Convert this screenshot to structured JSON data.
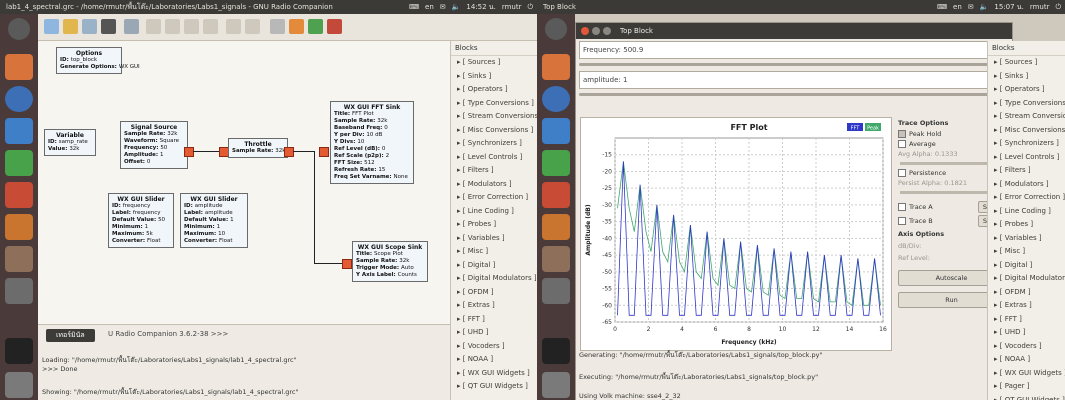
{
  "left_window": {
    "title": "lab1_4_spectral.grc - /home/rmutr/พื้นโต๊ะ/Laboratories/Labs1_signals - GNU Radio Companion",
    "status": {
      "lang": "en",
      "time": "14:52 น.",
      "user": "rmutr"
    },
    "blocks_panel": {
      "header": "Blocks",
      "items": [
        "[ Sources ]",
        "[ Sinks ]",
        "[ Operators ]",
        "[ Type Conversions ]",
        "[ Stream Conversions ]",
        "[ Misc Conversions ]",
        "[ Synchronizers ]",
        "[ Level Controls ]",
        "[ Filters ]",
        "[ Modulators ]",
        "[ Error Correction ]",
        "[ Line Coding ]",
        "[ Probes ]",
        "[ Variables ]",
        "[ Misc ]",
        "[ Digital ]",
        "[ Digital Modulators ]",
        "[ OFDM ]",
        "[ Extras ]",
        "[ FFT ]",
        "[ UHD ]",
        "[ Vocoders ]",
        "[ NOAA ]",
        "[ WX GUI Widgets ]",
        "[ QT GUI Widgets ]"
      ]
    },
    "flowgraph": {
      "options": {
        "title": "Options",
        "lines": [
          [
            "ID:",
            "top_block"
          ],
          [
            "Generate Options:",
            "WX GUI"
          ]
        ]
      },
      "variable": {
        "title": "Variable",
        "lines": [
          [
            "ID:",
            "samp_rate"
          ],
          [
            "Value:",
            "32k"
          ]
        ]
      },
      "signal_source": {
        "title": "Signal Source",
        "lines": [
          [
            "Sample Rate:",
            "32k"
          ],
          [
            "Waveform:",
            "Square"
          ],
          [
            "Frequency:",
            "50"
          ],
          [
            "Amplitude:",
            "1"
          ],
          [
            "Offset:",
            "0"
          ]
        ]
      },
      "throttle": {
        "title": "Throttle",
        "lines": [
          [
            "Sample Rate:",
            "32k"
          ]
        ]
      },
      "fft_sink": {
        "title": "WX GUI FFT Sink",
        "lines": [
          [
            "Title:",
            "FFT Plot"
          ],
          [
            "Sample Rate:",
            "32k"
          ],
          [
            "Baseband Freq:",
            "0"
          ],
          [
            "Y per Div:",
            "10 dB"
          ],
          [
            "Y Divs:",
            "10"
          ],
          [
            "Ref Level (dB):",
            "0"
          ],
          [
            "Ref Scale (p2p):",
            "2"
          ],
          [
            "FFT Size:",
            "512"
          ],
          [
            "Refresh Rate:",
            "15"
          ],
          [
            "Freq Set Varname:",
            "None"
          ]
        ]
      },
      "slider1": {
        "title": "WX GUI Slider",
        "lines": [
          [
            "ID:",
            "frequency"
          ],
          [
            "Label:",
            "frequency"
          ],
          [
            "Default Value:",
            "50"
          ],
          [
            "Minimum:",
            "1"
          ],
          [
            "Maximum:",
            "5k"
          ],
          [
            "Converter:",
            "Float"
          ]
        ]
      },
      "slider2": {
        "title": "WX GUI Slider",
        "lines": [
          [
            "ID:",
            "amplitude"
          ],
          [
            "Label:",
            "amplitude"
          ],
          [
            "Default Value:",
            "1"
          ],
          [
            "Minimum:",
            "1"
          ],
          [
            "Maximum:",
            "10"
          ],
          [
            "Converter:",
            "Float"
          ]
        ]
      },
      "scope_sink": {
        "title": "WX GUI Scope Sink",
        "lines": [
          [
            "Title:",
            "Scope Plot"
          ],
          [
            "Sample Rate:",
            "32k"
          ],
          [
            "Trigger Mode:",
            "Auto"
          ],
          [
            "Y Axis Label:",
            "Counts"
          ]
        ]
      }
    },
    "console": {
      "tab": "เทอร์มินัล",
      "tab_rest": "U Radio Companion 3.6.2-38 >>>",
      "lines": [
        "Loading: \"/home/rmutr/พื้นโต๊ะ/Laboratories/Labs1_signals/lab1_4_spectral.grc\"",
        ">>> Done",
        "Showing: \"/home/rmutr/พื้นโต๊ะ/Laboratories/Labs1_signals/lab1_4_spectral.grc\""
      ]
    }
  },
  "right_window": {
    "title": "Top Block",
    "status": {
      "lang": "en",
      "time": "15:07 น.",
      "user": "rmutr"
    },
    "window_title": "Top Block",
    "frequency_field": "Frequency: 500.9",
    "amplitude_field": "amplitude: 1",
    "fft_title": "FFT Plot",
    "legend": [
      "FFT",
      "Peak"
    ],
    "y_label": "Amplitude (dB)",
    "x_label": "Frequency (kHz)",
    "options": {
      "header": "Trace Options",
      "peak_hold": "Peak Hold",
      "average": "Average",
      "avg_alpha": "Avg Alpha: 0.1333",
      "persistence": "Persistence",
      "persist_alpha": "Persist Alpha: 0.1821",
      "trace_a": "Trace A",
      "trace_b": "Trace B",
      "store": "Store",
      "axis_header": "Axis Options",
      "db_div": "dB/Div:",
      "ref_level": "Ref Level:",
      "autoscale": "Autoscale",
      "run": "Run"
    },
    "output": [
      "Generating: \"/home/rmutr/พื้นโต๊ะ/Laboratories/Labs1_signals/top_block.py\"",
      "Executing: \"/home/rmutr/พื้นโต๊ะ/Laboratories/Labs1_signals/top_block.py\"",
      "Using Volk machine: sse4_2_32"
    ],
    "blocks_panel": {
      "header": "Blocks",
      "items": [
        "[ Sources ]",
        "[ Sinks ]",
        "[ Operators ]",
        "[ Type Conversions ]",
        "[ Stream Conversions ]",
        "[ Misc Conversions ]",
        "[ Synchronizers ]",
        "[ Level Controls ]",
        "[ Filters ]",
        "[ Modulators ]",
        "[ Error Correction ]",
        "[ Line Coding ]",
        "[ Probes ]",
        "[ Variables ]",
        "[ Misc ]",
        "[ Digital ]",
        "[ Digital Modulators ]",
        "[ OFDM ]",
        "[ Extras ]",
        "[ FFT ]",
        "[ UHD ]",
        "[ Vocoders ]",
        "[ NOAA ]",
        "[ WX GUI Widgets ]",
        "[ Pager ]",
        "[ QT GUI Widgets ]"
      ]
    }
  },
  "chart_data": {
    "type": "line",
    "title": "FFT Plot",
    "xlabel": "Frequency (kHz)",
    "ylabel": "Amplitude (dB)",
    "xlim": [
      0,
      16
    ],
    "ylim": [
      -65,
      -10
    ],
    "xticks": [
      0,
      2,
      4,
      6,
      8,
      10,
      12,
      14,
      16
    ],
    "yticks": [
      -15,
      -20,
      -25,
      -30,
      -35,
      -40,
      -45,
      -50,
      -55,
      -60,
      -65
    ],
    "peak_freqs_khz": [
      0.5,
      1.5,
      2.5,
      3.5,
      4.5,
      5.5,
      6.5,
      7.5,
      8.5,
      9.5,
      10.5,
      11.5,
      12.5,
      13.5,
      14.5,
      15.5
    ],
    "peak_levels_db": [
      -17,
      -24,
      -30,
      -33,
      -36,
      -38,
      -40,
      -41,
      -42,
      -43,
      -44,
      -44,
      -45,
      -45,
      -46,
      -46
    ],
    "floor_db": -63,
    "series": [
      {
        "name": "FFT",
        "color": "#2f37c9"
      },
      {
        "name": "Peak",
        "color": "#3fa86a"
      }
    ]
  }
}
